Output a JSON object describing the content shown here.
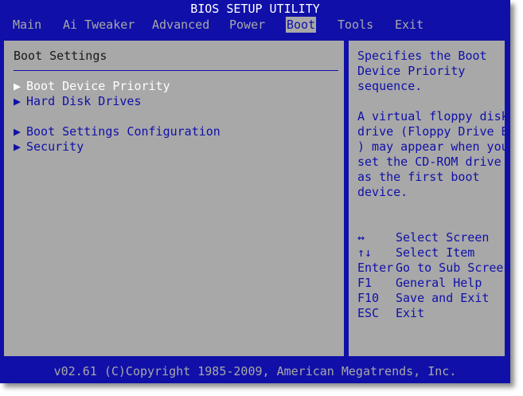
{
  "app": {
    "title": "BIOS SETUP UTILITY"
  },
  "menu": [
    {
      "label": "Main"
    },
    {
      "label": "Ai Tweaker"
    },
    {
      "label": "Advanced"
    },
    {
      "label": "Power"
    },
    {
      "label": "Boot"
    },
    {
      "label": "Tools"
    },
    {
      "label": "Exit"
    }
  ],
  "main": {
    "section_title": "Boot Settings",
    "arrow_glyph": "▶",
    "items": [
      {
        "label": "Boot Device Priority"
      },
      {
        "label": "Hard Disk Drives"
      },
      {
        "label": "Boot Settings Configuration"
      },
      {
        "label": "Security"
      }
    ]
  },
  "help": {
    "lines": [
      "Specifies the Boot",
      "Device Priority",
      "sequence.",
      "A virtual floppy disk",
      "drive (Floppy Drive B:",
      ") may appear when you",
      "set the CD-ROM drive",
      "as the first boot",
      "device."
    ],
    "keys": [
      {
        "key": "↔",
        "action": "Select Screen"
      },
      {
        "key": "↑↓",
        "action": "Select Item"
      },
      {
        "key": "Enter",
        "action": "Go to Sub Screen"
      },
      {
        "key": "F1",
        "action": "General Help"
      },
      {
        "key": "F10",
        "action": "Save and Exit"
      },
      {
        "key": "ESC",
        "action": "Exit"
      }
    ]
  },
  "footer": {
    "text": "v02.61 (C)Copyright 1985-2009, American Megatrends, Inc."
  },
  "colors": {
    "bios_blue": "#1010a8",
    "bios_gray": "#a8a8a8",
    "highlight": "#ffffff"
  }
}
